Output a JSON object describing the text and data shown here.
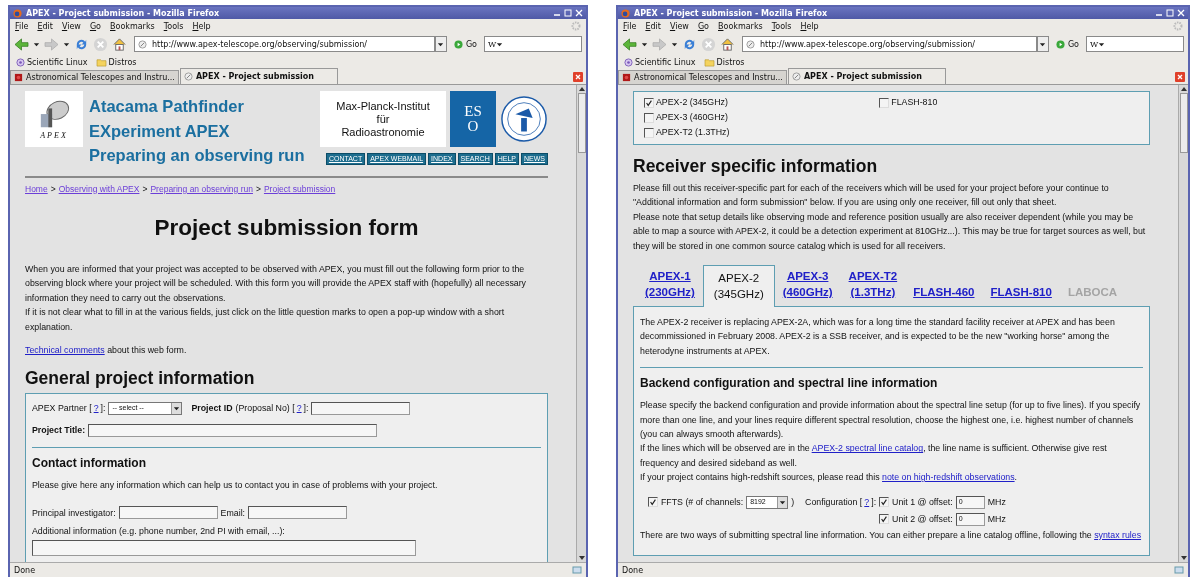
{
  "windows": [
    {
      "title": "APEX - Project submission - Mozilla Firefox",
      "menu": [
        "File",
        "Edit",
        "View",
        "Go",
        "Bookmarks",
        "Tools",
        "Help"
      ],
      "url": "http://www.apex-telescope.org/observing/submission/",
      "go_label": "Go",
      "search_value": "W",
      "bookmarks": [
        {
          "label": "Scientific Linux",
          "kind": "site"
        },
        {
          "label": "Distros",
          "kind": "folder"
        }
      ],
      "tabs": [
        {
          "label": "Astronomical Telescopes and Instru...",
          "selected": false
        },
        {
          "label": "APEX - Project submission",
          "selected": true
        }
      ],
      "blocks": [
        {
          "kind": "site_header",
          "logo_caption": "APEX",
          "titles": [
            "Atacama Pathfinder",
            "EXperiment APEX",
            "Preparing an observing run"
          ],
          "institute": [
            "Max-Planck-Institut",
            "für",
            "Radioastronomie"
          ],
          "eso_letters": [
            "ES",
            "O"
          ],
          "nav": [
            "CONTACT",
            "APEX WEBMAIL",
            "INDEX",
            "SEARCH",
            "HELP",
            "NEWS"
          ]
        },
        {
          "kind": "rule"
        },
        {
          "kind": "breadcrumb",
          "parts": [
            {
              "text": "Home",
              "link": true
            },
            {
              "text": ">",
              "link": false
            },
            {
              "text": "Observing with APEX",
              "link": true
            },
            {
              "text": ">",
              "link": false
            },
            {
              "text": "Preparing an observing run",
              "link": true
            },
            {
              "text": ">",
              "link": false
            },
            {
              "text": "Project submission",
              "link": true
            }
          ]
        },
        {
          "kind": "h1",
          "text": "Project submission form"
        },
        {
          "kind": "line",
          "parts": [
            {
              "text": "When you are informed that your project was accepted to be observed with APEX, you must fill out the following form prior to the observing block where your project will be scheduled. With this form you will provide the APEX staff with (hopefully) all necessary information they need to carry out the observations.",
              "link": false
            }
          ]
        },
        {
          "kind": "para",
          "parts": [
            {
              "text": "If it is not clear what to fill in at the various fields, just click on the little question marks to open a pop-up window with a short explanation.",
              "link": false
            }
          ]
        },
        {
          "kind": "para",
          "parts": [
            {
              "text": "Technical comments",
              "link": true
            },
            {
              "text": " about this web form.",
              "link": false
            }
          ]
        },
        {
          "kind": "h2",
          "text": "General project information"
        },
        {
          "kind": "box",
          "blocks": [
            {
              "kind": "row",
              "items": [
                {
                  "kind": "text",
                  "text": "APEX Partner ["
                },
                {
                  "kind": "link",
                  "text": "?"
                },
                {
                  "kind": "text",
                  "text": "]:"
                },
                {
                  "kind": "select",
                  "value": "-- select --"
                },
                {
                  "kind": "bold",
                  "text": "Project ID"
                },
                {
                  "kind": "text",
                  "text": "(Proposal No) ["
                },
                {
                  "kind": "link",
                  "text": "?"
                },
                {
                  "kind": "text",
                  "text": "]:"
                },
                {
                  "kind": "input"
                }
              ]
            },
            {
              "kind": "row",
              "items": [
                {
                  "kind": "bold",
                  "text": "Project Title:"
                },
                {
                  "kind": "wide_input"
                }
              ]
            },
            {
              "kind": "rule"
            },
            {
              "kind": "h3",
              "text": "Contact information"
            },
            {
              "kind": "para",
              "parts": [
                {
                  "text": "Please give here any information which can help us to contact you in case of problems with your project.",
                  "link": false
                }
              ]
            },
            {
              "kind": "row",
              "items": [
                {
                  "kind": "text",
                  "text": "Principal investigator:"
                },
                {
                  "kind": "input"
                },
                {
                  "kind": "text",
                  "text": "Email:"
                },
                {
                  "kind": "input"
                }
              ]
            },
            {
              "kind": "line",
              "parts": [
                {
                  "text": "Additional information (e.g. phone number, 2nd PI with email, ...):",
                  "link": false
                }
              ]
            },
            {
              "kind": "row",
              "items": [
                {
                  "kind": "textarea"
                }
              ]
            }
          ]
        }
      ],
      "status": "Done"
    },
    {
      "title": "APEX - Project submission - Mozilla Firefox",
      "menu": [
        "File",
        "Edit",
        "View",
        "Go",
        "Bookmarks",
        "Tools",
        "Help"
      ],
      "url": "http://www.apex-telescope.org/observing/submission/",
      "go_label": "Go",
      "search_value": "W",
      "bookmarks": [
        {
          "label": "Scientific Linux",
          "kind": "site"
        },
        {
          "label": "Distros",
          "kind": "folder"
        }
      ],
      "tabs": [
        {
          "label": "Astronomical Telescopes and Instru...",
          "selected": false
        },
        {
          "label": "APEX - Project submission",
          "selected": true
        }
      ],
      "blocks": [
        {
          "kind": "box",
          "blocks": [
            {
              "kind": "checkbox_columns",
              "columns": [
                [
                  {
                    "label": "APEX-2 (345GHz)",
                    "checked": true
                  },
                  {
                    "label": "APEX-3 (460GHz)",
                    "checked": false
                  },
                  {
                    "label": "APEX-T2 (1.3THz)",
                    "checked": false
                  }
                ],
                [
                  {
                    "label": "FLASH-810",
                    "checked": false
                  }
                ]
              ]
            }
          ]
        },
        {
          "kind": "h2",
          "text": "Receiver specific information"
        },
        {
          "kind": "line",
          "parts": [
            {
              "text": "Please fill out this receiver-specific part for each of the receivers which will be used for your project before your continue to \"Additional information and form submission\" below. If you are using only one receiver, fill out only that sheet.",
              "link": false
            }
          ]
        },
        {
          "kind": "para",
          "parts": [
            {
              "text": "Please note that setup details like observing mode and reference position usually are also receiver dependent (while you may be able to map a source with APEX-2, it could be a detection experiment at 810GHz...). This may be true for target sources as well, but they will be stored in one common source catalog which is used for all receivers.",
              "link": false
            }
          ]
        },
        {
          "kind": "receiver_tabs",
          "tabs": [
            {
              "lines": [
                "APEX-1",
                "(230GHz)"
              ],
              "selected": false,
              "disabled": false
            },
            {
              "lines": [
                "APEX-2",
                "(345GHz)"
              ],
              "selected": true,
              "disabled": false
            },
            {
              "lines": [
                "APEX-3",
                "(460GHz)"
              ],
              "selected": false,
              "disabled": false
            },
            {
              "lines": [
                "APEX-T2",
                "(1.3THz)"
              ],
              "selected": false,
              "disabled": false
            },
            {
              "lines": [
                "FLASH-460"
              ],
              "selected": false,
              "disabled": false
            },
            {
              "lines": [
                "FLASH-810"
              ],
              "selected": false,
              "disabled": false
            },
            {
              "lines": [
                "LABOCA"
              ],
              "selected": false,
              "disabled": true
            }
          ],
          "panel": [
            {
              "kind": "para",
              "parts": [
                {
                  "text": "The APEX-2 receiver is replacing APEX-2A, which was for a long time the standard facility receiver at APEX and has been decommissioned in February 2008. APEX-2 is a SSB receiver, and is expected to be the new \"working horse\" among the heterodyne instruments at APEX.",
                  "link": false
                }
              ]
            },
            {
              "kind": "rule"
            },
            {
              "kind": "h3",
              "text": "Backend configuration and spectral line information"
            },
            {
              "kind": "line",
              "parts": [
                {
                  "text": "Please specify the backend configuration and provide information about the spectral line setup (for up to five lines). If you specify more than one line, and your lines require different spectral resolution, choose the highest one, i.e. highest number of channels (you can always smooth afterwards).",
                  "link": false
                }
              ]
            },
            {
              "kind": "line",
              "parts": [
                {
                  "text": "If the lines which will be observed are in the ",
                  "link": false
                },
                {
                  "text": "APEX-2 spectral line catalog",
                  "link": true
                },
                {
                  "text": ", the line name is sufficient. Otherwise give rest frequency and desired sideband as well.",
                  "link": false
                }
              ]
            },
            {
              "kind": "para",
              "parts": [
                {
                  "text": "If your project contains high-redshift sources, please read this ",
                  "link": false
                },
                {
                  "text": "note on high-redshift observations",
                  "link": true
                },
                {
                  "text": ".",
                  "link": false
                }
              ]
            },
            {
              "kind": "backend_config",
              "ffts_checked": true,
              "ffts_label": "FFTS (# of channels:",
              "channels": "8192",
              "close": ")",
              "config_label": "Configuration [",
              "help": "?",
              "config_end": "]:",
              "units": [
                {
                  "checked": true,
                  "label": "Unit 1 @ offset:",
                  "value": "0",
                  "unit": "MHz"
                },
                {
                  "checked": true,
                  "label": "Unit 2 @ offset:",
                  "value": "0",
                  "unit": "MHz"
                }
              ]
            },
            {
              "kind": "para",
              "parts": [
                {
                  "text": "There are two ways of submitting spectral line information. You can either prepare a line catalog offline, following the ",
                  "link": false
                },
                {
                  "text": "syntax rules",
                  "link": true
                }
              ]
            }
          ]
        }
      ],
      "status": "Done"
    }
  ]
}
